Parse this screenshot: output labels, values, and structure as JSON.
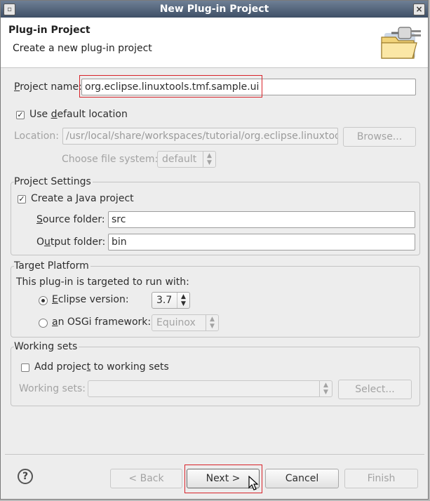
{
  "window": {
    "title": "New Plug-in Project"
  },
  "banner": {
    "title": "Plug-in Project",
    "description": "Create a new plug-in project",
    "icon": "new-plugin-wizard-icon"
  },
  "project_name": {
    "label": "Project name:",
    "mnemonic": "P",
    "rest": "roject name:",
    "value": "org.eclipse.linuxtools.tmf.sample.ui"
  },
  "use_default_location": {
    "label_pre": "Use ",
    "mnemonic": "d",
    "label_post": "efault location",
    "checked": true
  },
  "location": {
    "label": "Location:",
    "value": "/usr/local/share/workspaces/tutorial/org.eclipse.linuxtoo",
    "browse_label": "Browse..."
  },
  "file_system": {
    "label": "Choose file system:",
    "value": "default"
  },
  "project_settings": {
    "title": "Project Settings",
    "java_pre": "Create a ",
    "java_mnemonic": "J",
    "java_post": "ava project",
    "java_checked": true,
    "source_mnemonic": "S",
    "source_rest": "ource folder:",
    "source_value": "src",
    "output_pre": "O",
    "output_mnemonic": "u",
    "output_post": "tput folder:",
    "output_value": "bin"
  },
  "target_platform": {
    "title": "Target Platform",
    "description": "This plug-in is targeted to run with:",
    "eclipse_mnemonic": "E",
    "eclipse_rest": "clipse version:",
    "eclipse_value": "3.7",
    "eclipse_selected": true,
    "osgi_mnemonic": "a",
    "osgi_rest": "n OSGi framework:",
    "osgi_value": "Equinox"
  },
  "working_sets": {
    "title": "Working sets",
    "add_pre": "Add projec",
    "add_mnemonic": "t",
    "add_post": " to working sets",
    "add_checked": false,
    "label": "Working sets:",
    "select_label": "Select..."
  },
  "footer": {
    "help_glyph": "?",
    "back_label": "< Back",
    "next_label": "Next >",
    "cancel_label": "Cancel",
    "finish_label": "Finish"
  },
  "colors": {
    "highlight": "#d8232a",
    "title_bar": "#4f6079",
    "dialog_bg": "#ededed"
  }
}
